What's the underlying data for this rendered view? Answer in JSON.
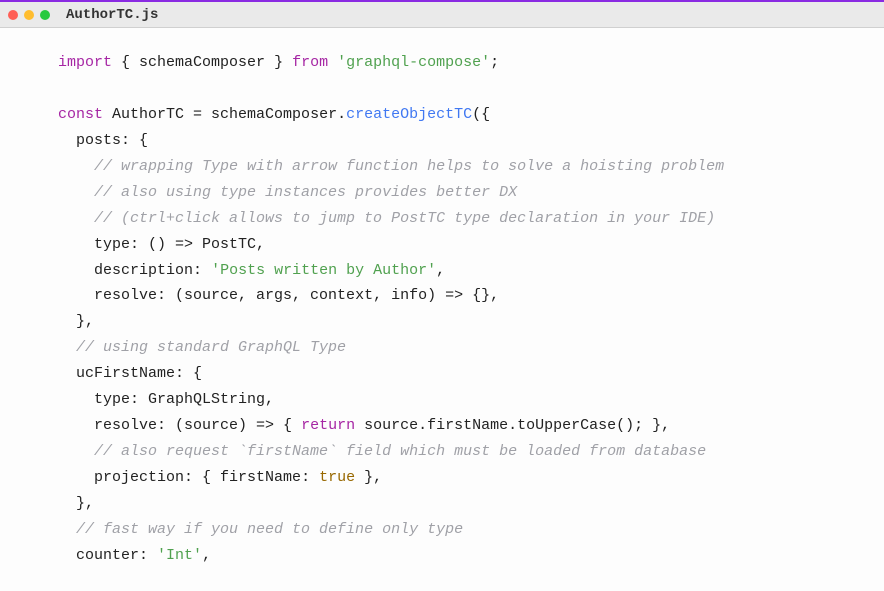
{
  "window": {
    "filename": "AuthorTC.js"
  },
  "code": {
    "l1_import": "import",
    "l1_braces_open": " { ",
    "l1_schemaComposer": "schemaComposer",
    "l1_braces_close": " } ",
    "l1_from": "from",
    "l1_space": " ",
    "l1_module": "'graphql-compose'",
    "l1_semi": ";",
    "l3_const": "const",
    "l3_name": " AuthorTC ",
    "l3_eq": "= ",
    "l3_sc": "schemaComposer",
    "l3_dot": ".",
    "l3_method": "createObjectTC",
    "l3_open": "({",
    "l4_indent": "  ",
    "l4_posts": "posts",
    "l4_colon": ": {",
    "l5_indent": "    ",
    "l5_cmt": "// wrapping Type with arrow function helps to solve a hoisting problem",
    "l6_indent": "    ",
    "l6_cmt": "// also using type instances provides better DX",
    "l7_indent": "    ",
    "l7_cmt": "// (ctrl+click allows to jump to PostTC type declaration in your IDE)",
    "l8_indent": "    ",
    "l8_type": "type",
    "l8_rest": ": () => PostTC,",
    "l9_indent": "    ",
    "l9_desc": "description",
    "l9_colon": ": ",
    "l9_str": "'Posts written by Author'",
    "l9_comma": ",",
    "l10_indent": "    ",
    "l10_resolve": "resolve",
    "l10_rest": ": (source, args, context, info) => {},",
    "l11_indent": "  ",
    "l11_close": "},",
    "l12_indent": "  ",
    "l12_cmt": "// using standard GraphQL Type",
    "l13_indent": "  ",
    "l13_uc": "ucFirstName",
    "l13_colon": ": {",
    "l14_indent": "    ",
    "l14_type": "type",
    "l14_rest": ": GraphQLString,",
    "l15_indent": "    ",
    "l15_resolve": "resolve",
    "l15_a": ": (source) => { ",
    "l15_return": "return",
    "l15_b": " source.firstName.toUpperCase(); },",
    "l16_indent": "    ",
    "l16_cmt": "// also request `firstName` field which must be loaded from database",
    "l17_indent": "    ",
    "l17_proj": "projection",
    "l17_a": ": { ",
    "l17_fn": "firstName",
    "l17_b": ": ",
    "l17_true": "true",
    "l17_c": " },",
    "l18_indent": "  ",
    "l18_close": "},",
    "l19_indent": "  ",
    "l19_cmt": "// fast way if you need to define only type",
    "l20_indent": "  ",
    "l20_counter": "counter",
    "l20_colon": ": ",
    "l20_str": "'Int'",
    "l20_comma": ","
  }
}
